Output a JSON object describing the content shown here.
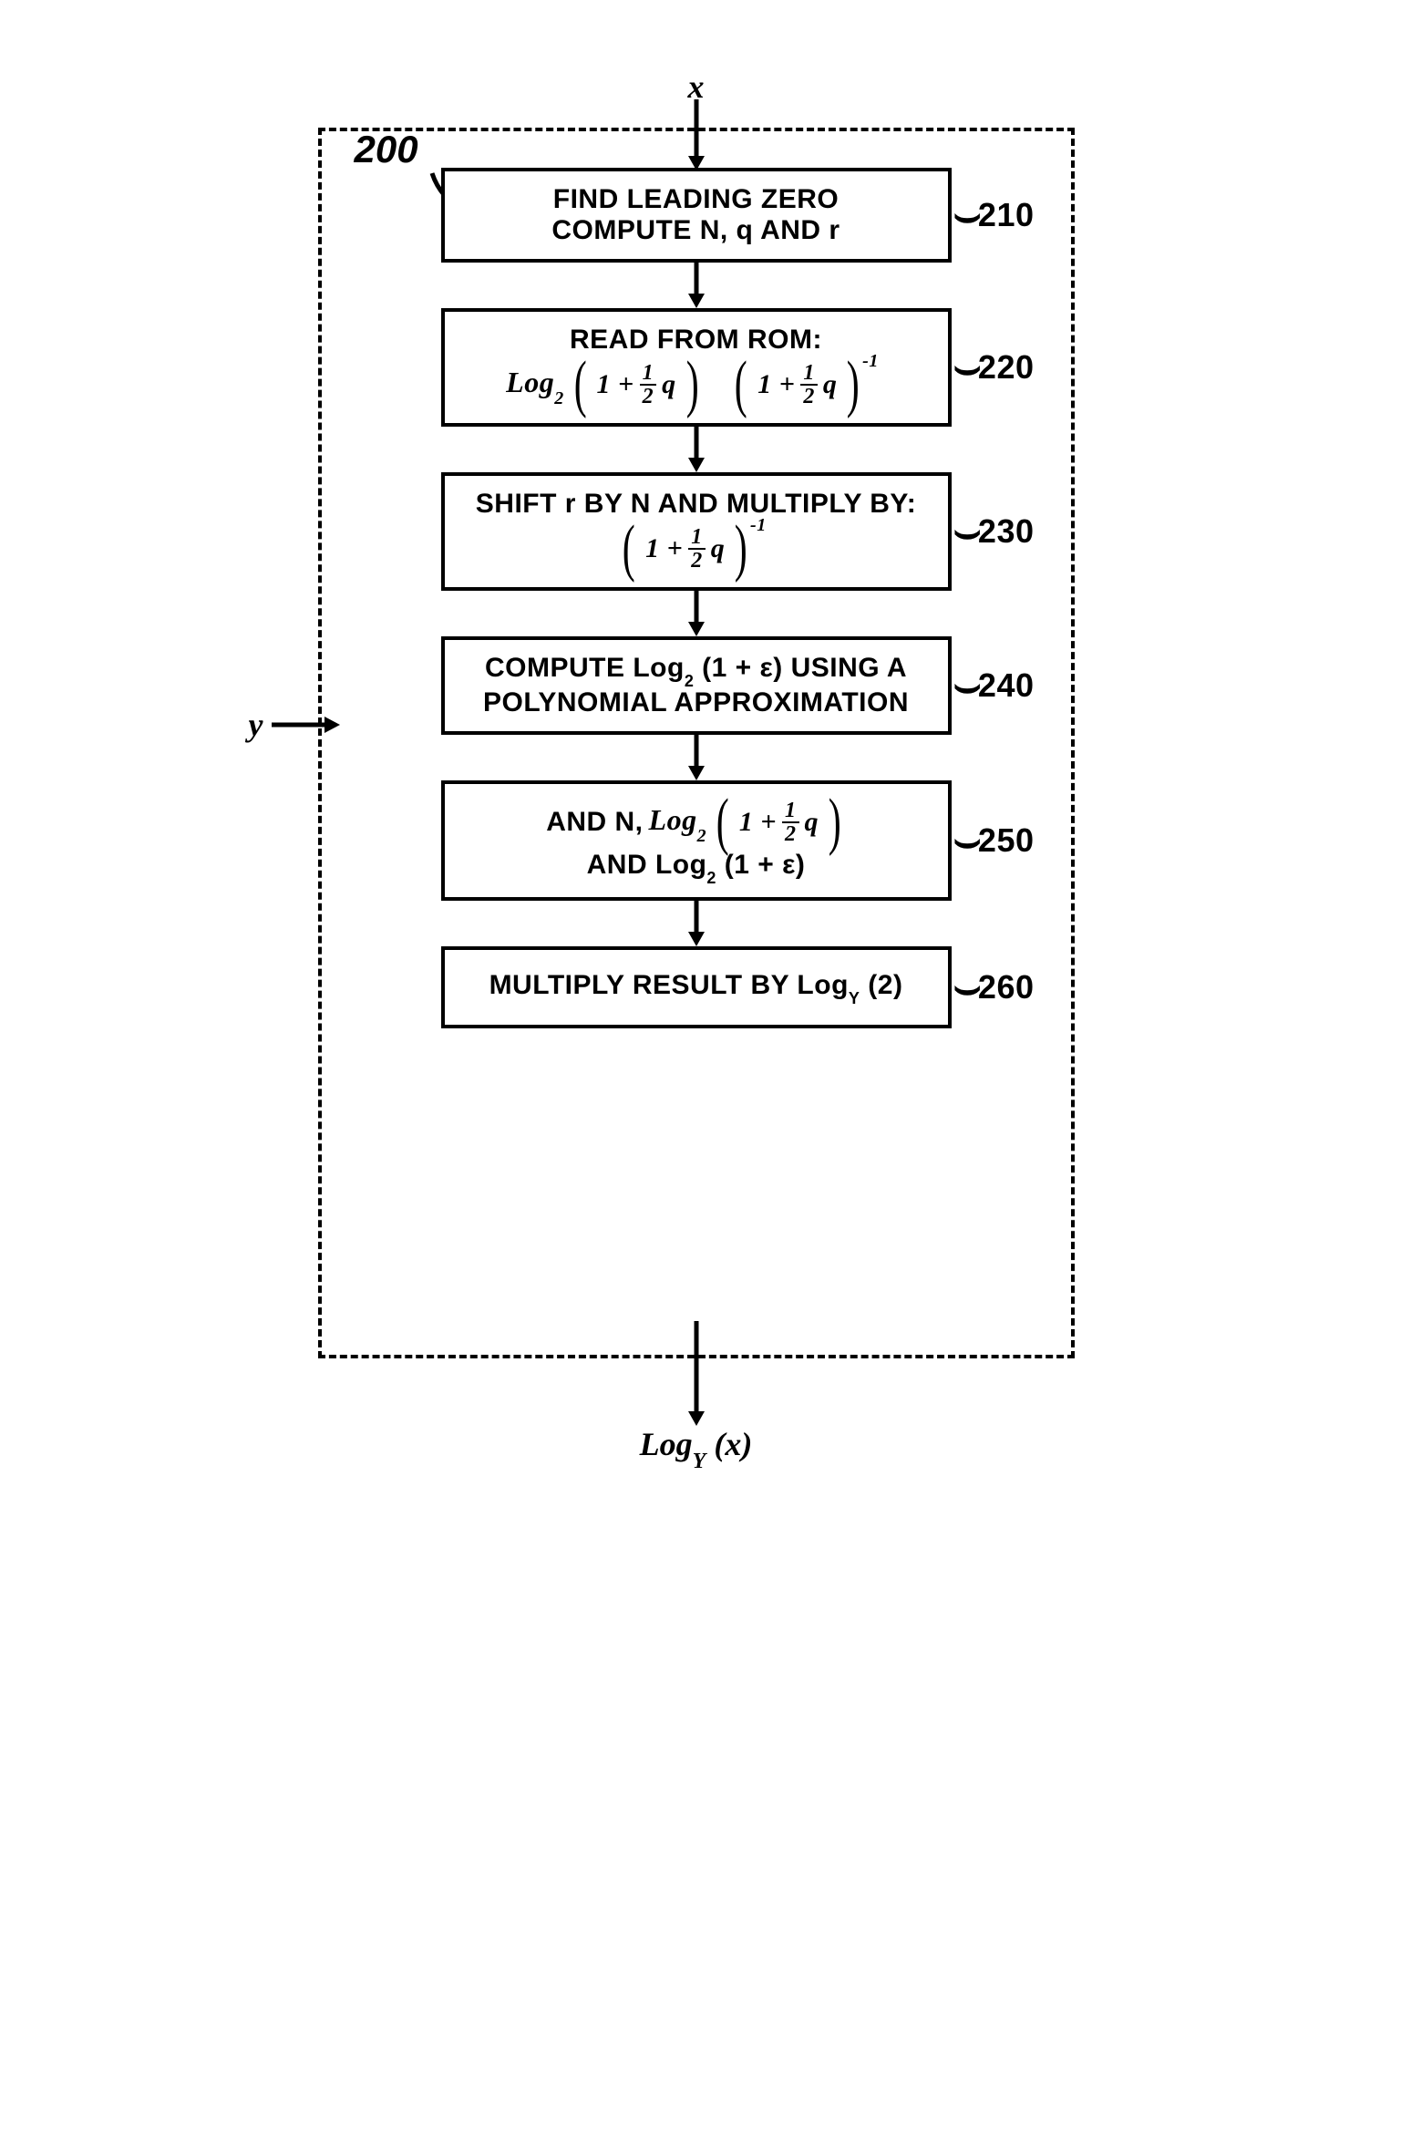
{
  "diagram": {
    "reference": "200",
    "input_top": "x",
    "input_side": "y",
    "output": "Log",
    "output_sub": "Y",
    "output_arg": "(x)",
    "blocks": {
      "b210": {
        "ref": "210",
        "line1": "FIND LEADING ZERO",
        "line2": "COMPUTE N, q AND r"
      },
      "b220": {
        "ref": "220",
        "title": "READ FROM ROM:"
      },
      "b230": {
        "ref": "230",
        "title": "SHIFT r BY N AND MULTIPLY BY:"
      },
      "b240": {
        "ref": "240",
        "prefix": "COMPUTE Log",
        "mid": " (1 + ε) USING A",
        "line2": "POLYNOMIAL APPROXIMATION"
      },
      "b250": {
        "ref": "250",
        "prefix": "AND N, ",
        "line2_prefix": "AND Log",
        "line2_suffix": " (1 + ε)"
      },
      "b260": {
        "ref": "260",
        "text": "MULTIPLY RESULT BY Log",
        "suffix": " (2)"
      }
    },
    "math": {
      "log": "Log",
      "sub2": "2",
      "subY": "Y",
      "one": "1",
      "two": "2",
      "half_q": "q",
      "neg1": "-1"
    }
  }
}
